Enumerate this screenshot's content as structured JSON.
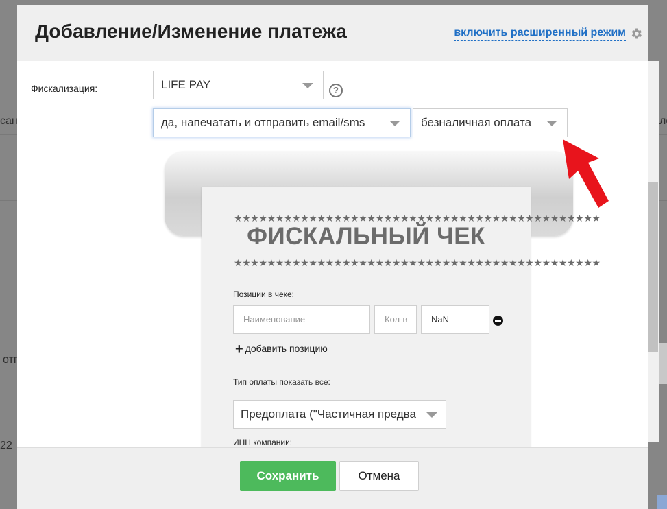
{
  "background_page": {
    "fragments": [
      "сан",
      "отп",
      "22",
      "ле"
    ]
  },
  "dialog": {
    "title": "Добавление/Изменение платежа",
    "advanced_mode_link": "включить расширенный режим",
    "gear_icon": "gear-icon"
  },
  "fiscal": {
    "label": "Фискализация:",
    "provider_select": "LIFE PAY",
    "help_icon": "question-circle-icon",
    "mode_select": "да, напечатать и отправить email/sms",
    "payment_method_select": "безналичная оплата"
  },
  "receipt": {
    "stars_top": "★★★★★★★★★★★★★★★★★★★★★★★★★★★★★★★★★★★★★★★★★★★★",
    "title": "ФИСКАЛЬНЫЙ ЧЕК",
    "stars_bottom": "★★★★★★★★★★★★★★★★★★★★★★★★★★★★★★★★★★★★★★★★★★★★",
    "positions_label": "Позиции в чеке:",
    "name_placeholder": "Наименование",
    "qty_placeholder": "Кол-в",
    "price_value": "NaN",
    "add_position": "добавить позицию",
    "payment_type_label": "Тип оплаты",
    "show_all_link": "показать все",
    "payment_type_colon": ":",
    "payment_type_select": "Предоплата (\"Частичная предва",
    "inn_label": "ИНН компании:"
  },
  "footer": {
    "save_label": "Сохранить",
    "cancel_label": "Отмена"
  },
  "colors": {
    "accent_link": "#1f6fc5",
    "save_button": "#4dba5c",
    "arrow": "#e8141c"
  }
}
